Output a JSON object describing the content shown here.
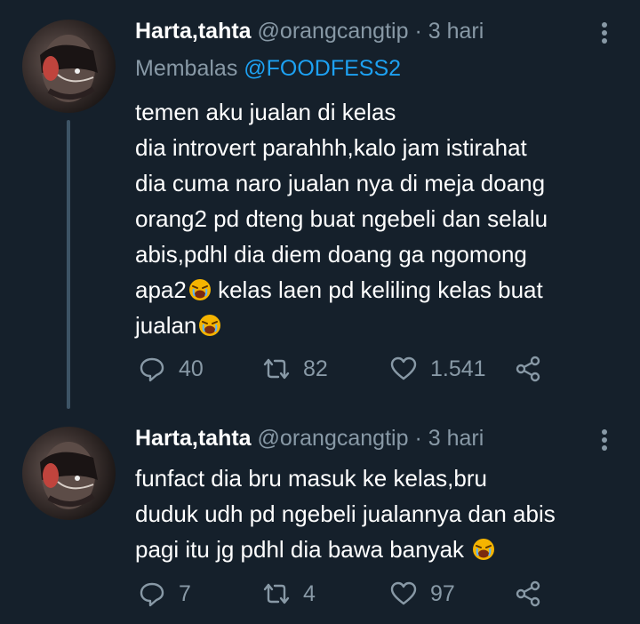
{
  "tweets": [
    {
      "author": {
        "name": "Harta,tahta",
        "handle": "@orangcangtip"
      },
      "separator": "·",
      "time": "3 hari",
      "reply_to": {
        "prefix": "Membalas ",
        "mention": "@FOODFESS2"
      },
      "lines": [
        "temen aku jualan di kelas",
        "dia introvert parahhh,kalo jam istirahat",
        "dia cuma naro jualan nya di meja doang",
        "orang2 pd dteng buat ngebeli dan selalu",
        "abis,pdhl dia diem doang ga ngomong",
        "apa2",
        " kelas laen pd keliling kelas buat",
        "jualan"
      ],
      "stats": {
        "replies": "40",
        "retweets": "82",
        "likes": "1.541"
      }
    },
    {
      "author": {
        "name": "Harta,tahta",
        "handle": "@orangcangtip"
      },
      "separator": "·",
      "time": "3 hari",
      "lines": [
        "funfact dia bru masuk ke kelas,bru",
        "duduk udh pd ngebeli jualannya dan abis",
        "pagi itu jg pdhl dia bawa banyak"
      ],
      "stats": {
        "replies": "7",
        "retweets": "4",
        "likes": "97"
      }
    }
  ],
  "icons": {
    "more": "more-vertical-icon",
    "reply": "reply-icon",
    "retweet": "retweet-icon",
    "like": "heart-icon",
    "share": "share-icon",
    "emoji": "crying-face-emoji"
  },
  "colors": {
    "background": "#15202b",
    "muted": "#8899a6",
    "link": "#1da1f2",
    "text": "#ffffff"
  }
}
